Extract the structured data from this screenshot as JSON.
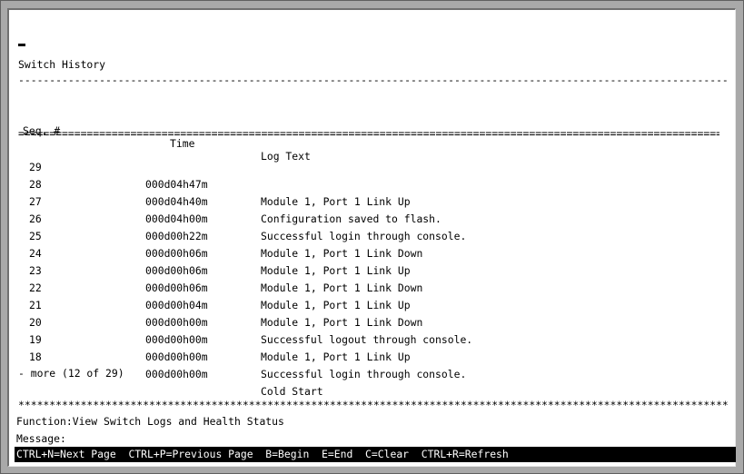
{
  "screen": {
    "title": "Switch History",
    "dashes": "----------------------------------------------------------------------------------------------------------------------------------------------------------------------------",
    "columns": {
      "seq": "Seq. #",
      "time": "Time",
      "log": "Log Text"
    },
    "equals": "=======================================================================================================================================================",
    "rows": [
      {
        "seq": "29",
        "time": "000d04h47m",
        "log": "Module 1, Port 1 Link Up"
      },
      {
        "seq": "28",
        "time": "000d04h40m",
        "log": "Configuration saved to flash."
      },
      {
        "seq": "27",
        "time": "000d04h00m",
        "log": "Successful login through console."
      },
      {
        "seq": "26",
        "time": "000d00h22m",
        "log": "Module 1, Port 1 Link Down"
      },
      {
        "seq": "25",
        "time": "000d00h06m",
        "log": "Module 1, Port 1 Link Up"
      },
      {
        "seq": "24",
        "time": "000d00h06m",
        "log": "Module 1, Port 1 Link Down"
      },
      {
        "seq": "23",
        "time": "000d00h06m",
        "log": "Module 1, Port 1 Link Up"
      },
      {
        "seq": "22",
        "time": "000d00h04m",
        "log": "Module 1, Port 1 Link Down"
      },
      {
        "seq": "21",
        "time": "000d00h00m",
        "log": "Successful logout through console."
      },
      {
        "seq": "20",
        "time": "000d00h00m",
        "log": "Module 1, Port 1 Link Up"
      },
      {
        "seq": "19",
        "time": "000d00h00m",
        "log": "Successful login through console."
      },
      {
        "seq": "18",
        "time": "000d00h00m",
        "log": "Cold Start"
      }
    ],
    "more": "- more (12 of 29)",
    "stars": "**************************************************************************************************************************************************",
    "function_line": "Function:View Switch Logs and Health Status",
    "message_line": "Message:",
    "hotkeys": "CTRL+N=Next Page  CTRL+P=Previous Page  B=Begin  E=End  C=Clear  CTRL+R=Refresh"
  }
}
